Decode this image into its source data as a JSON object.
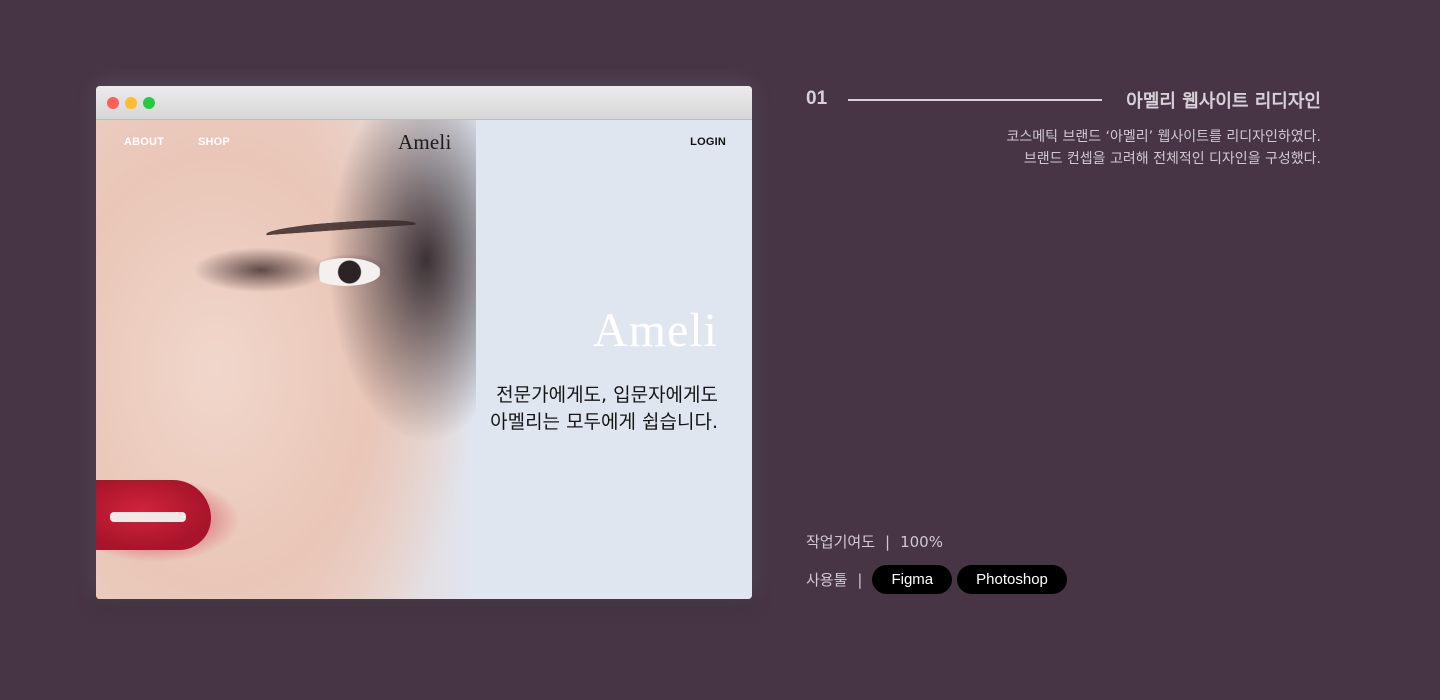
{
  "browser": {
    "nav": {
      "about": "ABOUT",
      "shop": "SHOP",
      "logo": "Ameli",
      "login": "LOGIN"
    },
    "hero": {
      "logo": "Ameli",
      "line1": "전문가에게도, 입문자에게도",
      "line2": "아멜리는 모두에게 쉽습니다."
    }
  },
  "project": {
    "number": "01",
    "title": "아멜리 웹사이트 리디자인",
    "desc1": "코스메틱 브랜드 ‘아멜리’ 웹사이트를 리디자인하였다.",
    "desc2": "브랜드 컨셉을 고려해 전체적인 디자인을 구성했다.",
    "contribution_label": "작업기여도",
    "contribution_sep": "|",
    "contribution_value": "100%",
    "tools_label": "사용툴",
    "tools_sep": "|",
    "tools": [
      "Figma",
      "Photoshop"
    ]
  },
  "colors": {
    "background": "#473546",
    "pill": "#000000",
    "browser_bg": "#e0e6f0"
  }
}
